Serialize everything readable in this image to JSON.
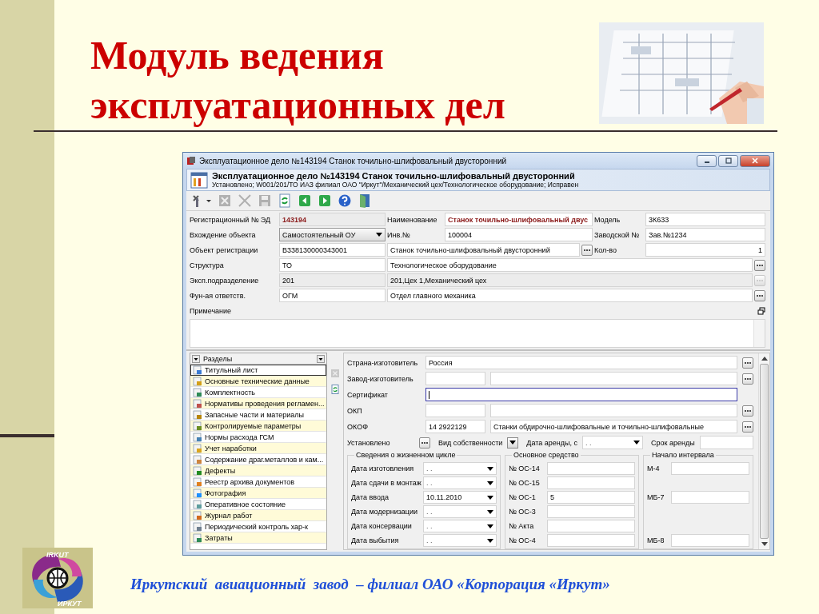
{
  "slide": {
    "title_lines": [
      "Модуль ведения",
      "эксплуатационных дел"
    ],
    "footer": "Иркутский  авиационный  завод  – филиал ОАО «Корпорация «Иркут»",
    "logo_texts": [
      "IRKUT",
      "ИРКУТ"
    ],
    "photo": {
      "kind": "picture"
    }
  },
  "window": {
    "title": "Эксплуатационное дело №143194 Станок точильно-шлифовальный двусторонний",
    "header": {
      "title": "Эксплуатационное дело №143194 Станок точильно-шлифовальный двусторонний",
      "subtitle": "Установлено; W001/201/ТО ИАЗ филиал ОАО \"Иркут\"/Механический цех/Технологическое оборудование; Исправен"
    },
    "toolbar": [
      {
        "kind": "tools",
        "disabled": false
      },
      {
        "kind": "cancel",
        "disabled": true
      },
      {
        "kind": "delete",
        "disabled": true
      },
      {
        "kind": "save",
        "disabled": true
      },
      {
        "kind": "refresh",
        "disabled": false
      },
      {
        "kind": "prev",
        "disabled": false
      },
      {
        "kind": "next",
        "disabled": false
      },
      {
        "kind": "help",
        "disabled": false
      },
      {
        "kind": "exit",
        "disabled": false
      }
    ],
    "form": {
      "registration_number": {
        "label": "Регистрационный № ЭД",
        "value": "143194"
      },
      "name": {
        "label": "Наименование",
        "value": "Станок точильно-шлифовальный двус"
      },
      "model": {
        "label": "Модель",
        "value": "3К633"
      },
      "membership": {
        "label": "Вхождение объекта",
        "value": "Самостоятельный ОУ"
      },
      "inventory_number": {
        "label": "Инв.№",
        "value": "100004"
      },
      "serial_number": {
        "label": "Заводской №",
        "value": "Зав.№1234"
      },
      "registration_object": {
        "label": "Объект регистрации",
        "code": "В338130000343001",
        "value": "Станок точильно-шлифовальный двусторонний"
      },
      "quantity": {
        "label": "Кол-во",
        "value": "1"
      },
      "lookups": [
        {
          "label": "Структура",
          "code": "ТО",
          "value": "Технологическое оборудование",
          "disabled": false
        },
        {
          "label": "Эксп.подразделение",
          "code": "201",
          "value": "201,Цех 1,Механический цех",
          "disabled": true
        },
        {
          "label": "Фун-ая ответств.",
          "code": "ОГМ",
          "value": "Отдел главного механика",
          "disabled": false
        }
      ],
      "note": {
        "label": "Примечание"
      }
    },
    "sections": {
      "header": "Разделы",
      "items": [
        {
          "label": "Титульный лист",
          "selected": true
        },
        {
          "label": "Основные технические данные",
          "selected": false
        },
        {
          "label": "Комплектность",
          "selected": false
        },
        {
          "label": "Нормативы проведения регламен...",
          "selected": false
        },
        {
          "label": "Запасные части и материалы",
          "selected": false
        },
        {
          "label": "Контролируемые параметры",
          "selected": false
        },
        {
          "label": "Нормы расхода ГСМ",
          "selected": false
        },
        {
          "label": "Учет наработки",
          "selected": false
        },
        {
          "label": "Содержание драг.металлов и кам...",
          "selected": false
        },
        {
          "label": "Дефекты",
          "selected": false
        },
        {
          "label": "Реестр архива документов",
          "selected": false
        },
        {
          "label": "Фотография",
          "selected": false
        },
        {
          "label": "Оперативное состояние",
          "selected": false
        },
        {
          "label": "Журнал работ",
          "selected": false
        },
        {
          "label": "Периодический контроль хар-к",
          "selected": false
        },
        {
          "label": "Затраты",
          "selected": false
        }
      ]
    },
    "details": {
      "country": {
        "label": "Страна-изготовитель",
        "value": "Россия"
      },
      "manufacturer": {
        "label": "Завод-изготовитель"
      },
      "certificate": {
        "label": "Сертификат",
        "focused": true
      },
      "okp": {
        "label": "ОКП"
      },
      "okof": {
        "label": "ОКОФ",
        "code": "14 2922129",
        "value": "Станки обдирочно-шлифовальные и точильно-шлифовальные"
      },
      "installed": {
        "label": "Установлено"
      },
      "ownership": {
        "label": "Вид собственности"
      },
      "lease_from": {
        "label": "Дата аренды, с",
        "placeholder": ". ."
      },
      "lease_term": {
        "label": "Срок аренды"
      },
      "lifecycle": {
        "title": "Сведения о жизненном цикле",
        "rows": [
          {
            "label": "Дата изготовления",
            "placeholder": ". ."
          },
          {
            "label": "Дата сдачи в монтаж",
            "placeholder": ". ."
          },
          {
            "label": "Дата ввода",
            "value": "10.11.2010"
          },
          {
            "label": "Дата модернизации",
            "placeholder": ". ."
          },
          {
            "label": "Дата консервации",
            "placeholder": ". ."
          },
          {
            "label": "Дата выбытия",
            "placeholder": ". ."
          }
        ]
      },
      "asset": {
        "title": "Основное средство",
        "rows": [
          {
            "label": "№ ОС-14"
          },
          {
            "label": "№ ОС-15"
          },
          {
            "label": "№ ОС-1",
            "value": "5"
          },
          {
            "label": "№ ОС-3"
          },
          {
            "label": "№ Акта"
          },
          {
            "label": "№ ОС-4"
          }
        ]
      },
      "interval": {
        "title": "Начало интервала",
        "rows": [
          {
            "label": "М-4"
          },
          {
            "label": "МБ-7"
          },
          {
            "label": "МБ-8"
          }
        ]
      }
    }
  }
}
